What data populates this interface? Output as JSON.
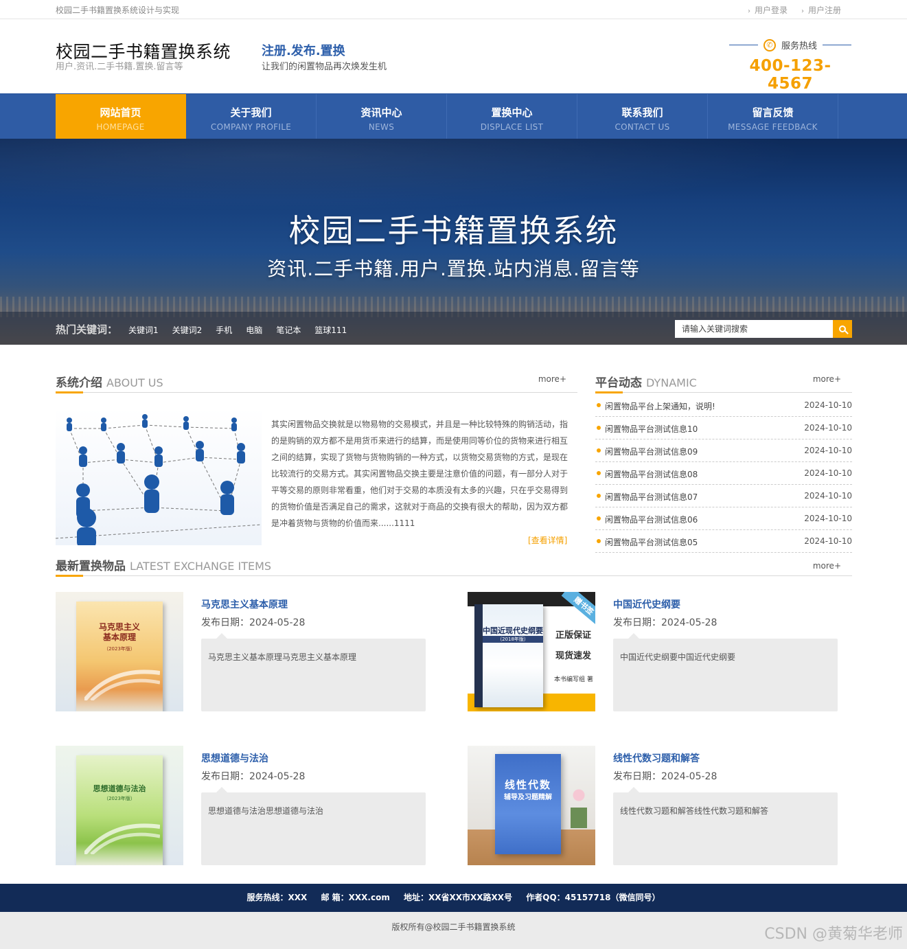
{
  "topbar": {
    "note": "校园二手书籍置换系统设计与实现",
    "links": [
      {
        "label": "用户登录"
      },
      {
        "label": "用户注册"
      }
    ]
  },
  "header": {
    "title": "校园二手书籍置换系统",
    "subtitle": "用户.资讯.二手书籍.置换.留言等",
    "slogan_title": "注册.发布.置换",
    "slogan_sub": "让我们的闲置物品再次焕发生机",
    "hotline_label": "服务热线",
    "hotline_number": "400-123-4567"
  },
  "nav": [
    {
      "zh": "网站首页",
      "en": "HOMEPAGE",
      "active": true
    },
    {
      "zh": "关于我们",
      "en": "COMPANY PROFILE"
    },
    {
      "zh": "资讯中心",
      "en": "NEWS"
    },
    {
      "zh": "置换中心",
      "en": "DISPLACE LIST"
    },
    {
      "zh": "联系我们",
      "en": "CONTACT US"
    },
    {
      "zh": "留言反馈",
      "en": "MESSAGE FEEDBACK"
    }
  ],
  "banner": {
    "title": "校园二手书籍置换系统",
    "subtitle": "资讯.二手书籍.用户.置换.站内消息.留言等",
    "hot_label": "热门关键词：",
    "hot_words": [
      "关键词1",
      "关键词2",
      "手机",
      "电脑",
      "笔记本",
      "篮球111"
    ],
    "search_placeholder": "请输入关键词搜索"
  },
  "about": {
    "title_zh": "系统介绍",
    "title_en": "ABOUT US",
    "more": "more+",
    "text": "其实闲置物品交换就是以物易物的交易模式，并且是一种比较特殊的购销活动，指的是购销的双方都不是用货币来进行的结算，而是使用同等价位的货物来进行相互之间的结算，实现了货物与货物购销的一种方式，以货物交易货物的方式，是现在比较流行的交易方式。其实闲置物品交换主要是注意价值的问题，有一部分人对于平等交易的原则非常看重，他们对于交易的本质没有太多的兴趣，只在乎交易得到的货物价值是否满足自己的需求，这就对于商品的交换有很大的帮助，因为双方都是冲着货物与货物的价值而来......1111",
    "detail_link": "[查看详情]"
  },
  "dynamic": {
    "title_zh": "平台动态",
    "title_en": "DYNAMIC",
    "more": "more+",
    "items": [
      {
        "title": "闲置物品平台上架通知，说明!",
        "date": "2024-10-10"
      },
      {
        "title": "闲置物品平台测试信息10",
        "date": "2024-10-10"
      },
      {
        "title": "闲置物品平台测试信息09",
        "date": "2024-10-10"
      },
      {
        "title": "闲置物品平台测试信息08",
        "date": "2024-10-10"
      },
      {
        "title": "闲置物品平台测试信息07",
        "date": "2024-10-10"
      },
      {
        "title": "闲置物品平台测试信息06",
        "date": "2024-10-10"
      },
      {
        "title": "闲置物品平台测试信息05",
        "date": "2024-10-10"
      }
    ]
  },
  "latest": {
    "title_zh": "最新置换物品",
    "title_en": "LATEST EXCHANGE ITEMS",
    "more": "more+",
    "items": [
      {
        "name": "马克思主义基本原理",
        "date": "发布日期：2024-05-28",
        "desc": "马克思主义基本原理马克思主义基本原理",
        "cover_title": "马克思主义\n基本原理",
        "cover_year": "（2023年版）"
      },
      {
        "name": "中国近代史纲要",
        "date": "发布日期：2024-05-28",
        "desc": "中国近代史纲要中国近代史纲要",
        "cover_title": "中国近现代史纲要",
        "cover_year": "（2018年版）",
        "cover_badges": [
          "正版保证",
          "现货速发"
        ],
        "cover_author": "本书编写组 著",
        "cover_corner": "赠书签"
      },
      {
        "name": "思想道德与法治",
        "date": "发布日期：2024-05-28",
        "desc": "思想道德与法治思想道德与法治",
        "cover_title": "思想道德与法治",
        "cover_year": "（2023年版）"
      },
      {
        "name": "线性代数习题和解答",
        "date": "发布日期：2024-05-28",
        "desc": "线性代数习题和解答线性代数习题和解答",
        "cover_title": "线性代数",
        "cover_sub": "辅导及习题精解"
      }
    ]
  },
  "footer": {
    "hotline": "服务热线：XXX",
    "email": "邮 箱：XXX.com",
    "address": "地址：XX省XX市XX路XX号",
    "qq": "作者QQ：45157718（微信同号）",
    "copyright": "版权所有@校园二手书籍置换系统"
  },
  "watermark": "CSDN @黄菊华老师",
  "colors": {
    "nav_bg": "#2f5ca5",
    "accent": "#f8a500",
    "footer_bg": "#122b57",
    "link_blue": "#2c5eaa"
  }
}
